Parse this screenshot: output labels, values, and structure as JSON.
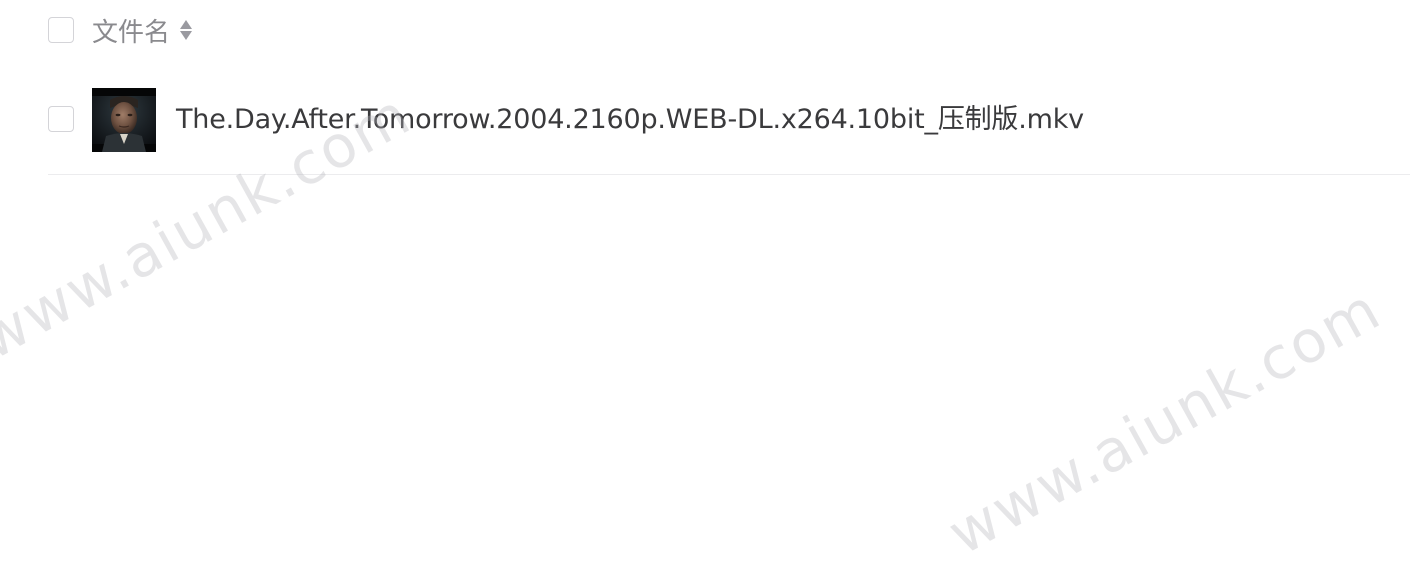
{
  "header": {
    "column_label": "文件名",
    "sort_icon": "sort-updown-icon"
  },
  "files": [
    {
      "name": "The.Day.After.Tomorrow.2004.2160p.WEB-DL.x264.10bit_压制版.mkv",
      "thumbnail_icon": "video-thumbnail"
    }
  ],
  "watermarks": [
    "www.aiunk.com",
    "www.aiunk.com"
  ],
  "colors": {
    "background": "#ffffff",
    "header_text": "#8a8a8e",
    "file_text": "#3a3a3c",
    "checkbox_border": "#d4d4d8",
    "divider": "#ececee"
  }
}
